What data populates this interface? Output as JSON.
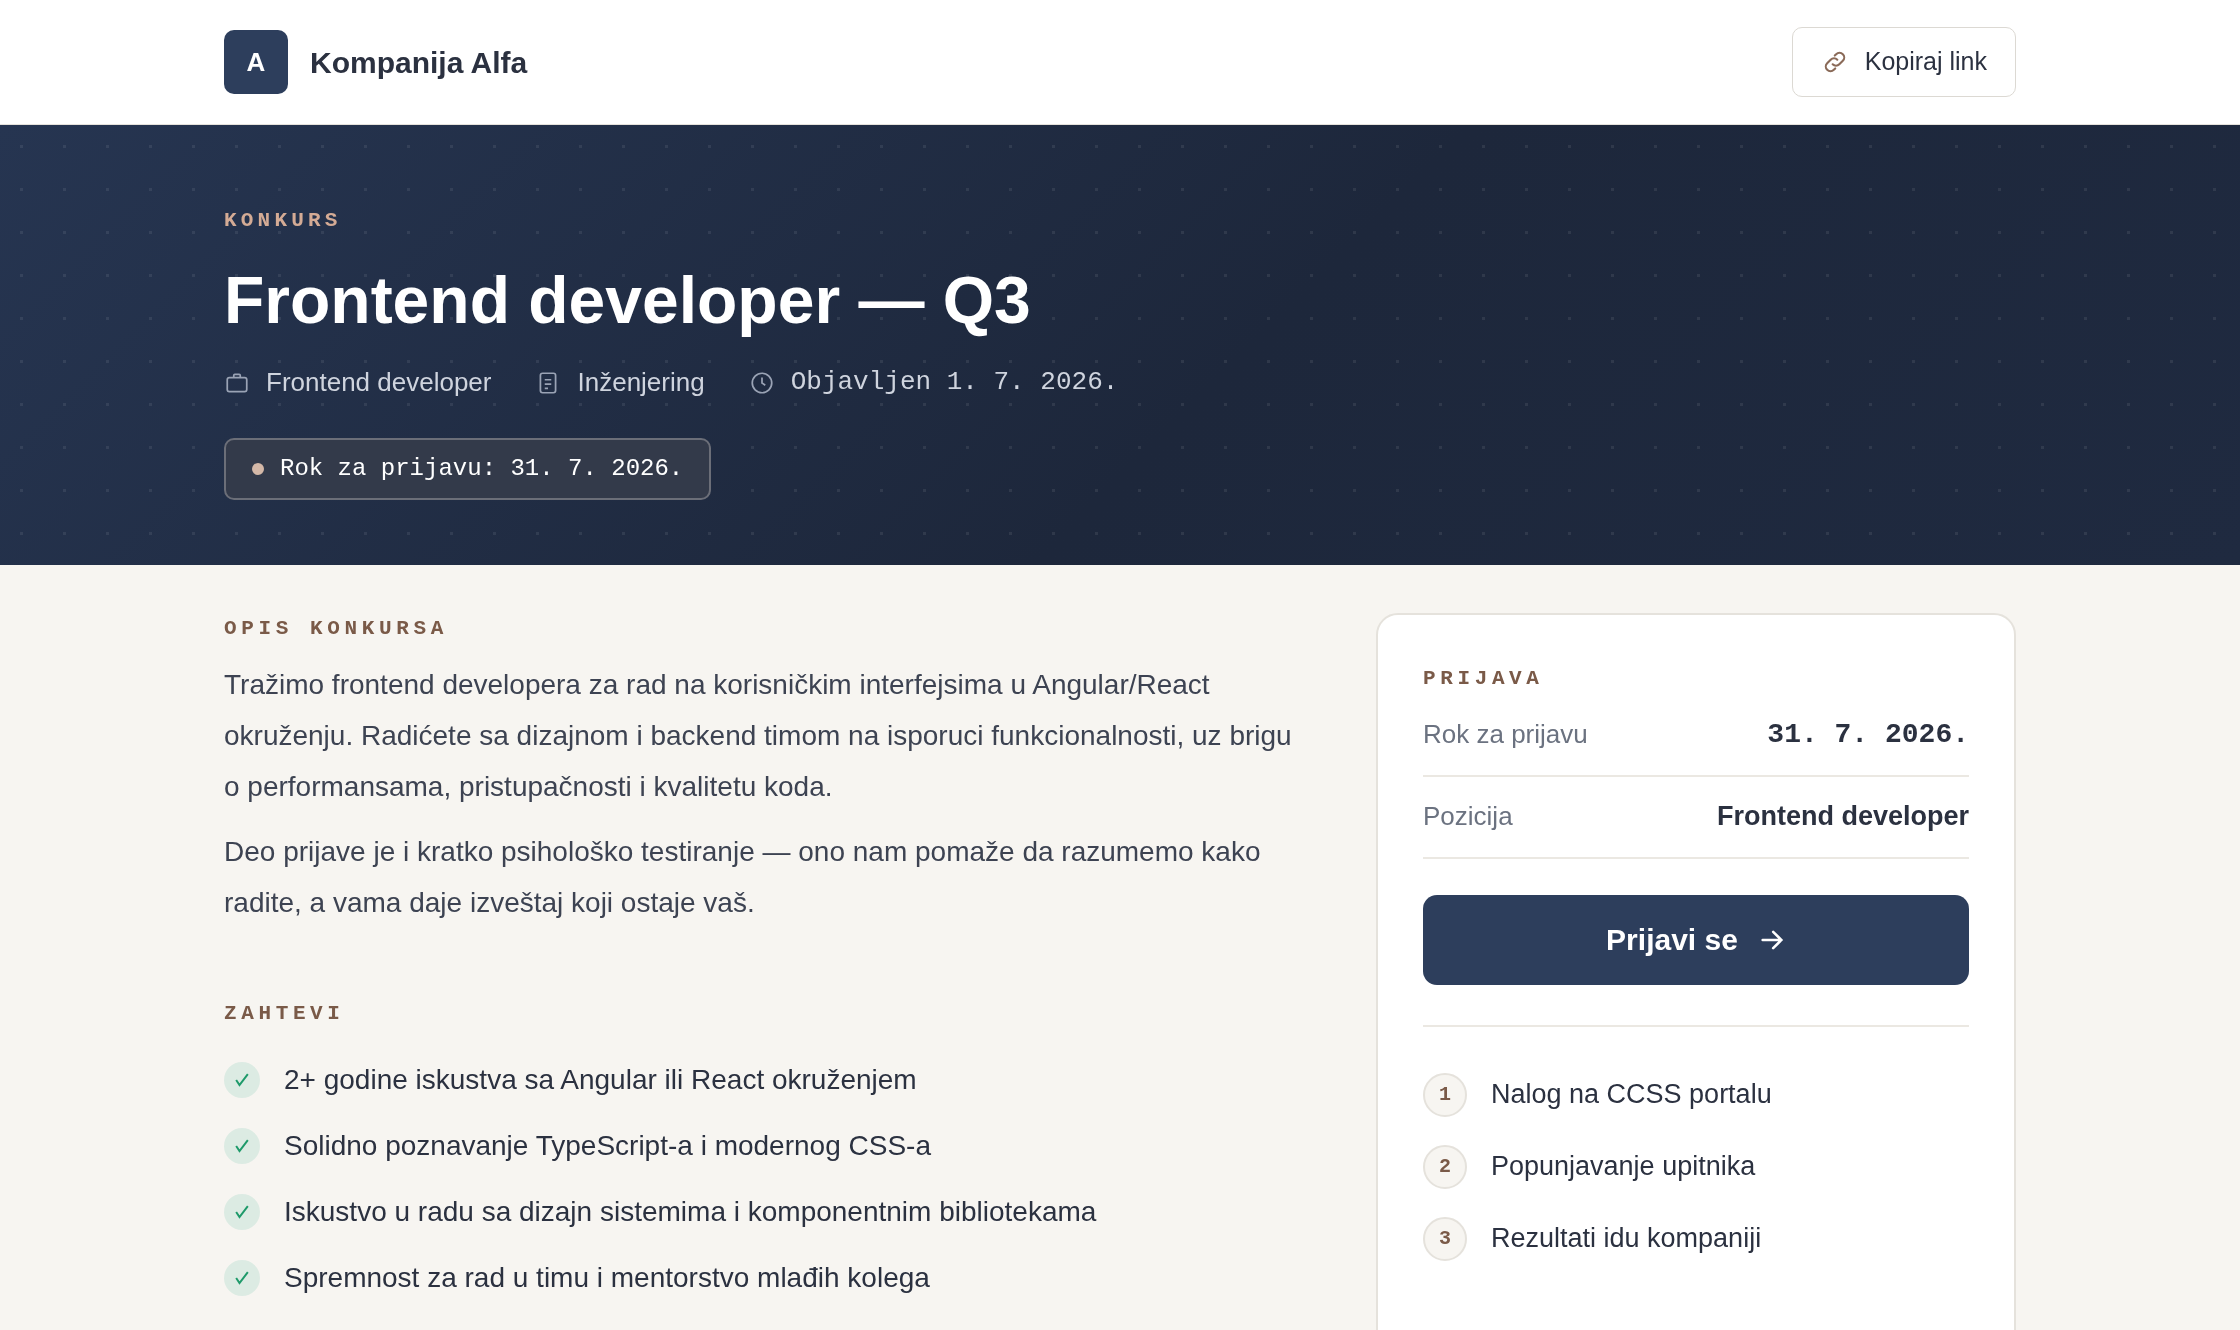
{
  "header": {
    "logo_letter": "A",
    "company": "Kompanija Alfa",
    "copy_button": "Kopiraj link"
  },
  "hero": {
    "kicker": "KONKURS",
    "title": "Frontend developer — Q3",
    "meta": [
      {
        "kind": "role",
        "text": "Frontend developer"
      },
      {
        "kind": "department",
        "text": "Inženjering"
      },
      {
        "kind": "date",
        "text": "Objavljen 1. 7. 2026."
      }
    ],
    "deadline_badge": "Rok za prijavu: 31. 7. 2026."
  },
  "description": {
    "heading": "OPIS KONKURSA",
    "paragraphs": [
      "Tražimo frontend developera za rad na korisničkim interfejsima u Angular/React okruženju. Radićete sa dizajnom i backend timom na isporuci funkcionalnosti, uz brigu o performansama, pristupačnosti i kvalitetu koda.",
      "Deo prijave je i kratko psihološko testiranje — ono nam pomaže da razumemo kako radite, a vama daje izveštaj koji ostaje vaš."
    ]
  },
  "requirements": {
    "heading": "ZAHTEVI",
    "items": [
      "2+ godine iskustva sa Angular ili React okruženjem",
      "Solidno poznavanje TypeScript-a i modernog CSS-a",
      "Iskustvo u radu sa dizajn sistemima i komponentnim bibliotekama",
      "Spremnost za rad u timu i mentorstvo mlađih kolega"
    ]
  },
  "application_card": {
    "heading": "PRIJAVA",
    "rows": [
      {
        "label": "Rok za prijavu",
        "value": "31. 7. 2026.",
        "kind": "date"
      },
      {
        "label": "Pozicija",
        "value": "Frontend developer",
        "kind": "text"
      }
    ],
    "apply_button": "Prijavi se",
    "steps": [
      {
        "number": "1",
        "text": "Nalog na CCSS portalu"
      },
      {
        "number": "2",
        "text": "Popunjavanje upitnika"
      },
      {
        "number": "3",
        "text": "Rezultati idu kompaniji"
      }
    ]
  }
}
